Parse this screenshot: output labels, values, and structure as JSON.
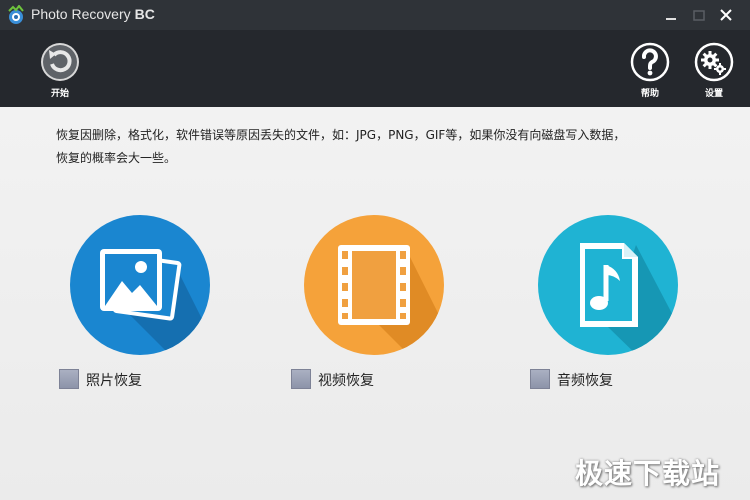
{
  "window": {
    "title": "Photo Recovery",
    "title_suffix": "BC"
  },
  "toolbar": {
    "start_label": "开始",
    "help_label": "帮助",
    "settings_label": "设置"
  },
  "description": {
    "line1": "恢复因删除，格式化，软件错误等原因丢失的文件，如：JPG，PNG，GIF等，如果你没有向磁盘写入数据，",
    "line2": "恢复的概率会大一些。"
  },
  "options": [
    {
      "label": "照片恢复",
      "color": "#1a86d0",
      "icon": "image-icon",
      "checked": false
    },
    {
      "label": "视频恢复",
      "color": "#f5a23a",
      "icon": "film-icon",
      "checked": false
    },
    {
      "label": "音频恢复",
      "color": "#1fb3d3",
      "icon": "music-file-icon",
      "checked": false
    }
  ],
  "watermark": "极速下载站",
  "colors": {
    "titlebar": "#2f3338",
    "toolbar": "#25282d",
    "content_bg": "#ececec"
  }
}
